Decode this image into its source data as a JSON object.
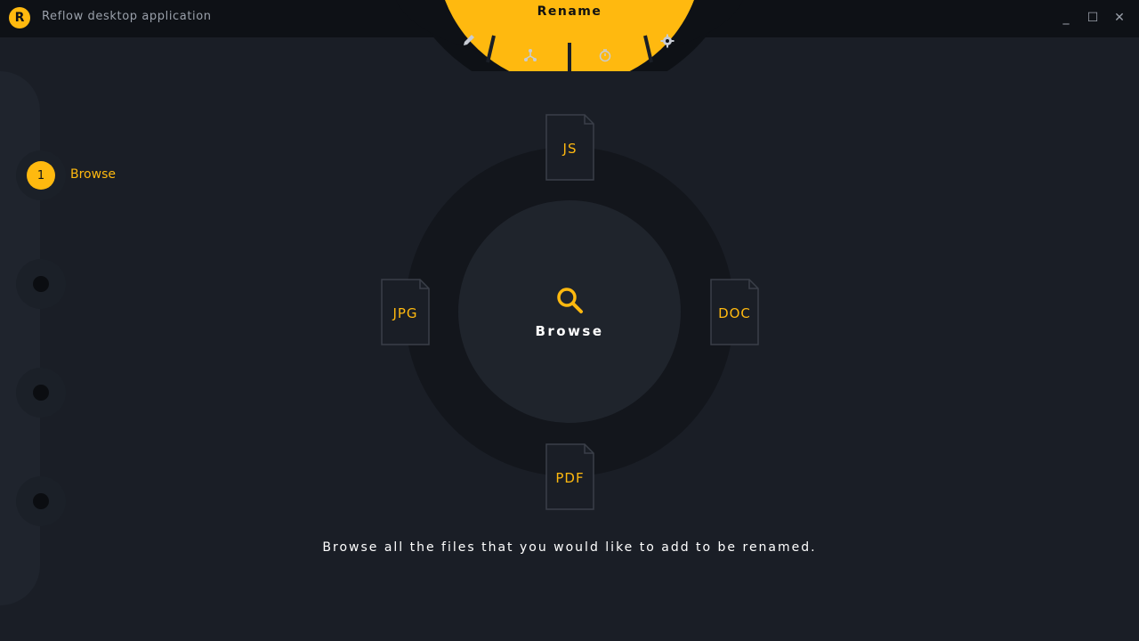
{
  "window": {
    "title": "Reflow desktop application",
    "logo_letter": "R",
    "minimize_glyph": "_",
    "maximize_glyph": "☐",
    "close_glyph": "✕"
  },
  "top_menu": {
    "active_label": "Rename",
    "icons": [
      "pencil-icon",
      "network-icon",
      "stopwatch-icon",
      "gear-icon"
    ]
  },
  "stepper": {
    "steps": [
      {
        "number": "1",
        "label": "Browse",
        "active": true
      },
      {
        "number": "",
        "label": "",
        "active": false
      },
      {
        "number": "",
        "label": "",
        "active": false
      },
      {
        "number": "",
        "label": "",
        "active": false
      }
    ]
  },
  "center": {
    "button_label": "Browse",
    "icon": "search-icon"
  },
  "file_types": {
    "top": "JS",
    "left": "JPG",
    "right": "DOC",
    "bottom": "PDF"
  },
  "hint": "Browse all the files that you would like to add to be renamed.",
  "colors": {
    "accent": "#ffb90f",
    "background": "#1a1e26",
    "titlebar": "#0e1116"
  }
}
